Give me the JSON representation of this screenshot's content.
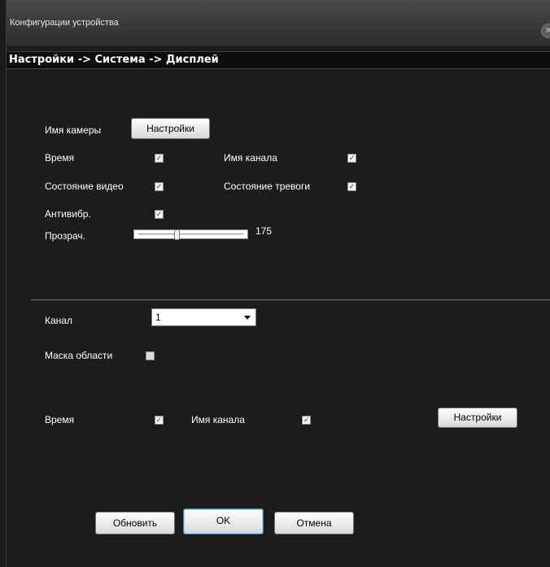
{
  "window": {
    "title": "Конфигурации устройства",
    "close_symbol": "✕"
  },
  "breadcrumb": "Настройки -> Система -> Дисплей",
  "osd": {
    "camera_name_label": "Имя камеры",
    "settings_button": "Настройки",
    "time_label": "Время",
    "time_checked": true,
    "channel_name_label": "Имя канала",
    "channel_name_checked": true,
    "video_status_label": "Состояние видео",
    "video_status_checked": true,
    "alarm_status_label": "Состояние тревоги",
    "alarm_status_checked": true,
    "antishake_label": "Антивибр.",
    "antishake_checked": true,
    "transparency_label": "Прозрач.",
    "transparency_value": "175"
  },
  "channel": {
    "channel_label": "Канал",
    "channel_value": "1",
    "area_mask_label": "Маска области",
    "area_mask_checked": false,
    "time_label": "Время",
    "time_checked": true,
    "channel_name_label": "Имя канала",
    "channel_name_checked": true,
    "settings_button": "Настройки"
  },
  "footer": {
    "refresh_button": "Обновить",
    "ok_button": "OK",
    "cancel_button": "Отмена"
  },
  "check_symbol": "✓"
}
